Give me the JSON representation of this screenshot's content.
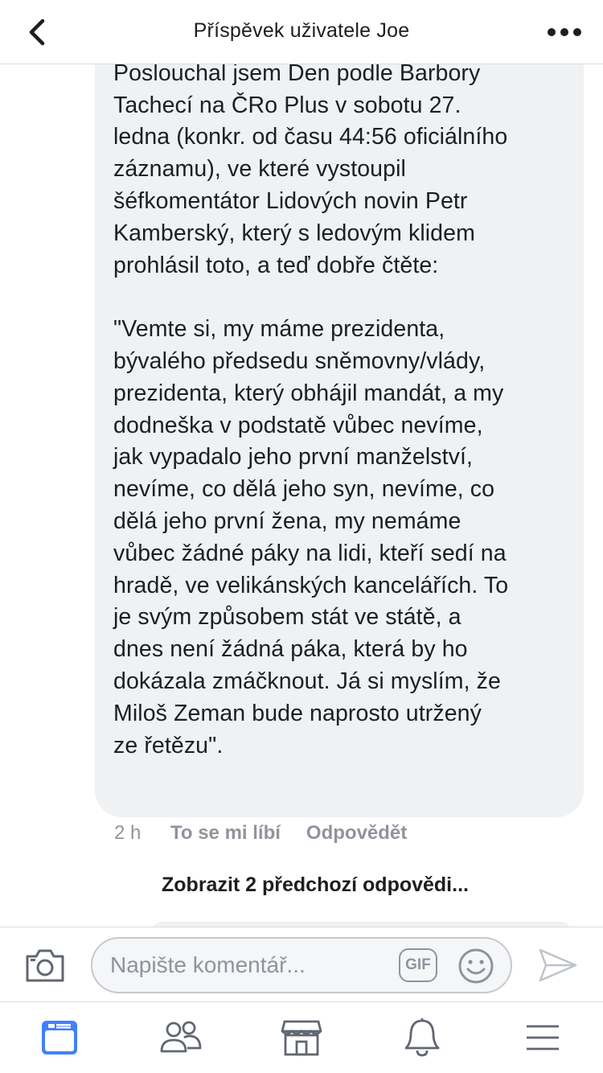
{
  "header": {
    "title": "Příspěvek uživatele Joe",
    "back_icon": "chevron-left-icon",
    "more_icon": "more-dots-icon"
  },
  "comment": {
    "text": "na veřejnoprávním rozhlase!\nPoslouchal jsem Den podle Barbory\nTachecí na ČRo Plus v sobotu 27.\nledna (konkr. od času 44:56 oficiálního\nzáznamu), ve které vystoupil\nšéfkomentátor Lidových novin Petr\nKamberský, který s ledovým klidem\nprohlásil toto, a teď dobře čtěte:\n\n\"Vemte si, my máme prezidenta,\nbývalého předsedu sněmovny/vlády,\nprezidenta, který obhájil mandát, a my\ndodneška v podstatě vůbec nevíme,\njak vypadalo jeho první manželství,\nnevíme, co dělá jeho syn, nevíme, co\ndělá jeho první žena, my nemáme\nvůbec žádné páky na lidi, kteří sedí na\nhradě, ve velikánských kancelářích. To\nje svým způsobem stát ve státě, a\ndnes není žádná páka, která by ho\ndokázala zmáčknout. Já si myslím, že\nMiloš Zeman bude naprosto utržený\nze řetězu\".",
    "time": "2 h",
    "like_label": "To se mi líbí",
    "reply_label": "Odpovědět"
  },
  "show_previous_label": "Zobrazit 2 předchozí odpovědi...",
  "composer": {
    "placeholder": "Napište komentář...",
    "gif_label": "GIF",
    "camera_icon": "camera-icon",
    "emoji_icon": "smiley-icon",
    "send_icon": "send-icon"
  },
  "tabbar": {
    "items": [
      "news-feed-icon",
      "friends-icon",
      "marketplace-icon",
      "notifications-bell-icon",
      "menu-icon"
    ],
    "active_color": "#4080ff",
    "inactive_color": "#606770"
  }
}
